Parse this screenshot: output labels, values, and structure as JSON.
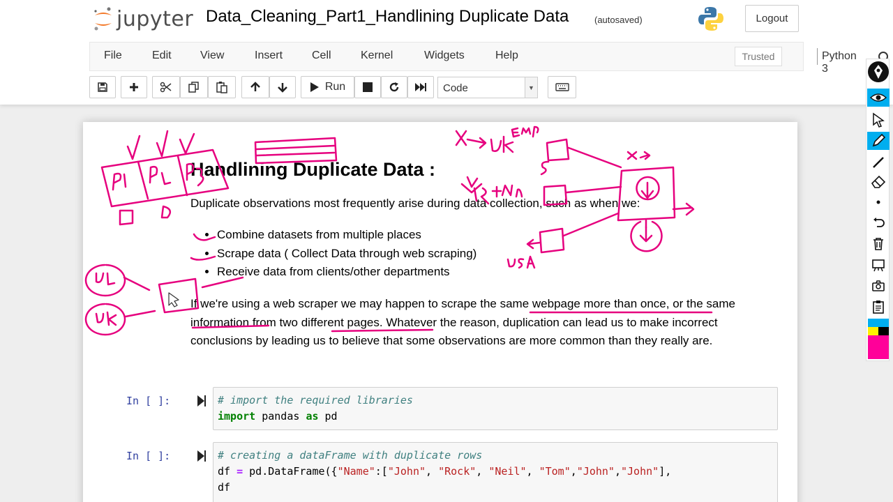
{
  "header": {
    "logo_text": "jupyter",
    "notebook_title": "Data_Cleaning_Part1_Handlining Duplicate Data",
    "autosave_status": "(autosaved)",
    "logout_label": "Logout"
  },
  "menu": {
    "items": [
      "File",
      "Edit",
      "View",
      "Insert",
      "Cell",
      "Kernel",
      "Widgets",
      "Help"
    ],
    "trusted_label": "Trusted",
    "kernel_name": "Python 3"
  },
  "toolbar": {
    "run_label": "Run",
    "cell_type": "Code",
    "icons": [
      "save-icon",
      "plus-icon",
      "scissors-icon",
      "copy-icon",
      "paste-icon",
      "arrow-up-icon",
      "arrow-down-icon",
      "play-icon",
      "stop-icon",
      "restart-icon",
      "fast-forward-icon",
      "keyboard-icon"
    ]
  },
  "markdown": {
    "heading": "Handlining Duplicate Data :",
    "intro": "Duplicate observations most frequently arise during data collection, such as when we:",
    "bullets": [
      "Combine datasets from multiple places",
      "Scrape data ( Collect Data through web scraping)",
      "Receive data from clients/other departments"
    ],
    "paragraph": "If we're using a web scraper we may happen to scrape the same webpage more than once, or the same information from two different pages. Whatever the reason, duplication can lead us to make incorrect conclusions by leading us to believe that some observations are more common than they really are."
  },
  "cells": [
    {
      "prompt": "In [ ]:",
      "line1_comment": "# import the required libraries",
      "line2_keyword1": "import",
      "line2_module": " pandas ",
      "line2_keyword2": "as",
      "line2_alias": " pd"
    },
    {
      "prompt": "In [ ]:",
      "line1_comment": "# creating a dataFrame with duplicate rows",
      "line2_a": "df ",
      "line2_eq": "=",
      "line2_b": " pd.DataFrame({",
      "line2_key": "\"Name\"",
      "line2_c": ":[",
      "line2_s1": "\"John\"",
      "line2_s2": "\"Rock\"",
      "line2_s3": "\"Neil\"",
      "line2_s4": "\"Tom\"",
      "line2_s5": "\"John\"",
      "line2_s6": "\"John\"",
      "line2_end": "],",
      "line3": "df"
    }
  ],
  "annotations": {
    "ink_color": "#e6007e",
    "handwritten": [
      "P1",
      "P2",
      "P3",
      "D",
      "D",
      "X",
      "UK",
      "Emp",
      "S",
      "UK+Ind",
      "X",
      "USA",
      "UL",
      "UK"
    ]
  },
  "pen_palette": {
    "colors": [
      "#00aeef",
      "#ffef00",
      "#000000",
      "#ff0099",
      "#ff0099"
    ],
    "tools": [
      "pen-logo-icon",
      "eye-icon",
      "cursor-icon",
      "pen-icon",
      "line-icon",
      "eraser-icon",
      "dot-icon",
      "undo-icon",
      "trash-icon",
      "whiteboard-icon",
      "camera-icon",
      "clipboard-icon"
    ]
  }
}
